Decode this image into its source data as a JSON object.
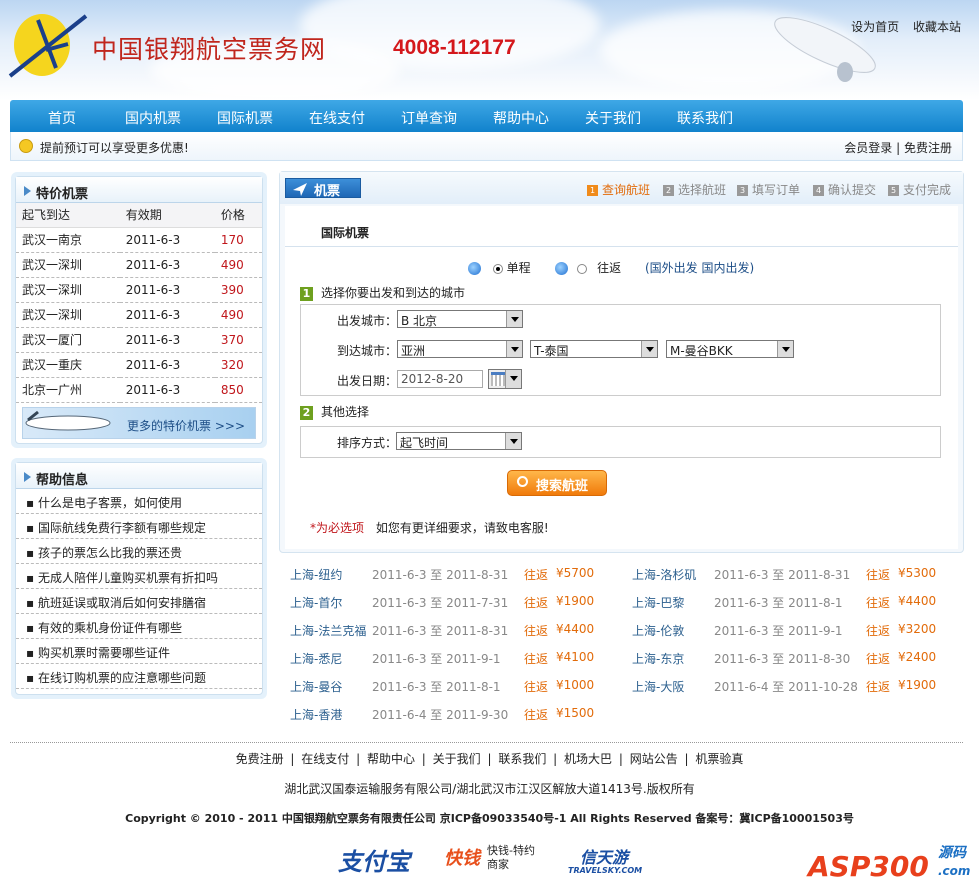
{
  "header": {
    "site_name": "中国银翔航空票务网",
    "phone": "4008-112177",
    "links": [
      "设为首页",
      "收藏本站"
    ]
  },
  "nav": [
    "首页",
    "国内机票",
    "国际机票",
    "在线支付",
    "订单查询",
    "帮助中心",
    "关于我们",
    "联系我们"
  ],
  "notice": {
    "text": "提前预订可以享受更多优惠!",
    "login": "会员登录",
    "register": "免费注册"
  },
  "deals_box": {
    "title": "特价机票",
    "headers": [
      "起飞到达",
      "有效期",
      "价格"
    ],
    "rows": [
      [
        "武汉一南京",
        "2011-6-3",
        "170"
      ],
      [
        "武汉一深圳",
        "2011-6-3",
        "490"
      ],
      [
        "武汉一深圳",
        "2011-6-3",
        "390"
      ],
      [
        "武汉一深圳",
        "2011-6-3",
        "490"
      ],
      [
        "武汉一厦门",
        "2011-6-3",
        "370"
      ],
      [
        "武汉一重庆",
        "2011-6-3",
        "320"
      ],
      [
        "北京一广州",
        "2011-6-3",
        "850"
      ]
    ],
    "more": "更多的特价机票 >>>"
  },
  "help_box": {
    "title": "帮助信息",
    "items": [
      "什么是电子客票，如何使用",
      "国际航线免费行李额有哪些规定",
      "孩子的票怎么比我的票还贵",
      "无成人陪伴儿童购买机票有折扣吗",
      "航班延误或取消后如何安排膳宿",
      "有效的乘机身份证件有哪些",
      "购买机票时需要哪些证件",
      "在线订购机票的应注意哪些问题"
    ]
  },
  "search": {
    "tab": "机票",
    "steps": [
      "查询航班",
      "选择航班",
      "填写订单",
      "确认提交",
      "支付完成"
    ],
    "title": "国际机票",
    "trip_oneway": "单程",
    "trip_round": "往返",
    "origin_links": [
      "(国外出发",
      "国内出发)"
    ],
    "section1": "选择你要出发和到达的城市",
    "depart_label": "出发城市：",
    "depart_value": "B 北京",
    "arrive_label": "到达城市：",
    "arrive_region": "亚洲",
    "arrive_country": "T-泰国",
    "arrive_city": "M-曼谷BKK",
    "date_label": "出发日期：",
    "date_value": "2012-8-20",
    "section2": "其他选择",
    "sort_label": "排序方式：",
    "sort_value": "起飞时间",
    "button": "搜索航班",
    "required_note": "*为必选项",
    "help_note": "如您有更详细要求，请致电客服!"
  },
  "specials": [
    [
      "上海-纽约",
      "2011-6-3 至 2011-8-31",
      "往返",
      "¥5700"
    ],
    [
      "上海-洛杉矶",
      "2011-6-3 至 2011-8-31",
      "往返",
      "¥5300"
    ],
    [
      "上海-首尔",
      "2011-6-3 至 2011-7-31",
      "往返",
      "¥1900"
    ],
    [
      "上海-巴黎",
      "2011-6-3 至 2011-8-1",
      "往返",
      "¥4400"
    ],
    [
      "上海-法兰克福",
      "2011-6-3 至 2011-8-31",
      "往返",
      "¥4400"
    ],
    [
      "上海-伦敦",
      "2011-6-3 至 2011-9-1",
      "往返",
      "¥3200"
    ],
    [
      "上海-悉尼",
      "2011-6-3 至 2011-9-1",
      "往返",
      "¥4100"
    ],
    [
      "上海-东京",
      "2011-6-3 至 2011-8-30",
      "往返",
      "¥2400"
    ],
    [
      "上海-曼谷",
      "2011-6-3 至 2011-8-1",
      "往返",
      "¥1000"
    ],
    [
      "上海-大阪",
      "2011-6-4 至 2011-10-28",
      "往返",
      "¥1900"
    ],
    [
      "上海-香港",
      "2011-6-4 至 2011-9-30",
      "往返",
      "¥1500"
    ]
  ],
  "footer": {
    "links": [
      "免费注册",
      "在线支付",
      "帮助中心",
      "关于我们",
      "联系我们",
      "机场大巴",
      "网站公告",
      "机票验真"
    ],
    "address": "湖北武汉国泰运输服务有限公司/湖北武汉市江汉区解放大道1413号.版权所有",
    "copyright": "Copyright © 2010 - 2011 中国银翔航空票务有限责任公司  京ICP备09033540号-1 All Rights Reserved 备案号：冀ICP备10001503号",
    "logos": [
      "支付宝",
      "快钱",
      "快钱-特约商家",
      "信天游",
      "TRAVELSKY.COM",
      "ASP300",
      "源码",
      ".com"
    ]
  }
}
